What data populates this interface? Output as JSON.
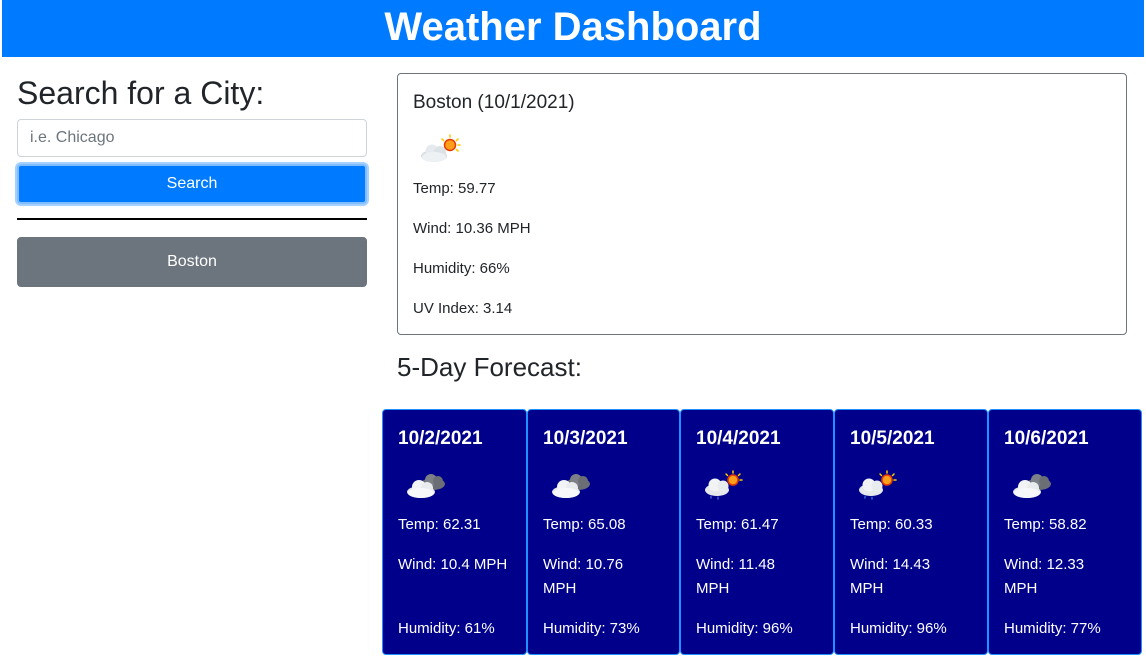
{
  "header": {
    "title": "Weather Dashboard"
  },
  "search": {
    "title": "Search for a City:",
    "placeholder": "i.e. Chicago",
    "value": "",
    "button_label": "Search"
  },
  "history": {
    "cities": [
      "Boston"
    ]
  },
  "current": {
    "city_date": "Boston (10/1/2021)",
    "icon": "partly-cloudy-day-icon",
    "temp": "Temp: 59.77",
    "wind": "Wind: 10.36 MPH",
    "humidity": "Humidity: 66%",
    "uv": "UV Index: 3.14"
  },
  "forecast": {
    "title": "5-Day Forecast:",
    "days": [
      {
        "date": "10/2/2021",
        "icon": "cloudy-night-icon",
        "temp": "Temp: 62.31",
        "wind": "Wind: 10.4 MPH",
        "humidity": "Humidity: 61%"
      },
      {
        "date": "10/3/2021",
        "icon": "cloudy-night-icon",
        "temp": "Temp: 65.08",
        "wind": "Wind: 10.76 MPH",
        "humidity": "Humidity: 73%"
      },
      {
        "date": "10/4/2021",
        "icon": "rain-sun-icon",
        "temp": "Temp: 61.47",
        "wind": "Wind: 11.48 MPH",
        "humidity": "Humidity: 96%"
      },
      {
        "date": "10/5/2021",
        "icon": "rain-sun-icon",
        "temp": "Temp: 60.33",
        "wind": "Wind: 14.43 MPH",
        "humidity": "Humidity: 96%"
      },
      {
        "date": "10/6/2021",
        "icon": "cloudy-night-icon",
        "temp": "Temp: 58.82",
        "wind": "Wind: 12.33 MPH",
        "humidity": "Humidity: 77%"
      }
    ]
  },
  "colors": {
    "header_bg": "#007bff",
    "search_button_bg": "#007bff",
    "history_button_bg": "#6c757d",
    "forecast_card_bg": "#00008b",
    "forecast_card_border": "#1e90ff"
  }
}
